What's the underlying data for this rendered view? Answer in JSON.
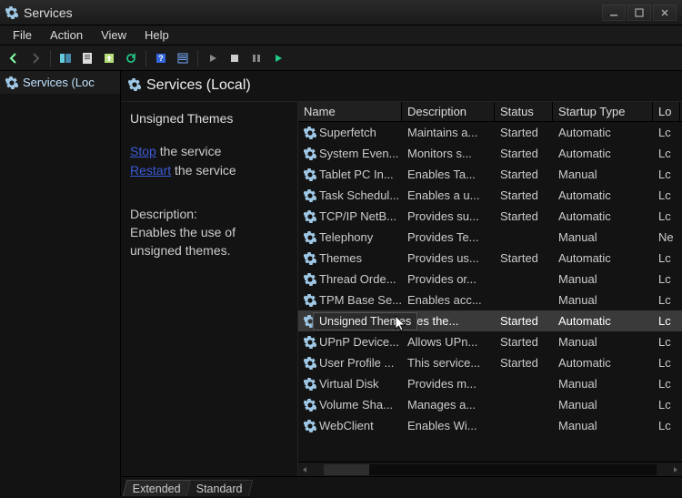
{
  "window": {
    "title": "Services"
  },
  "menu": {
    "items": [
      "File",
      "Action",
      "View",
      "Help"
    ]
  },
  "left": {
    "tab": "Services (Loc"
  },
  "header": {
    "title": "Services (Local)"
  },
  "detail": {
    "service_name": "Unsigned Themes",
    "stop_label": "Stop",
    "stop_suffix": " the service",
    "restart_label": "Restart",
    "restart_suffix": " the service",
    "desc_heading": "Description:",
    "desc_text": "Enables the use of unsigned themes."
  },
  "columns": {
    "name": "Name",
    "description": "Description",
    "status": "Status",
    "startup": "Startup Type",
    "logon": "Lo"
  },
  "rows": [
    {
      "name": "Superfetch",
      "desc": "Maintains a...",
      "status": "Started",
      "start": "Automatic",
      "logon": "Lc"
    },
    {
      "name": "System Even...",
      "desc": "Monitors s...",
      "status": "Started",
      "start": "Automatic",
      "logon": "Lc"
    },
    {
      "name": "Tablet PC In...",
      "desc": "Enables Ta...",
      "status": "Started",
      "start": "Manual",
      "logon": "Lc"
    },
    {
      "name": "Task Schedul...",
      "desc": "Enables a u...",
      "status": "Started",
      "start": "Automatic",
      "logon": "Lc"
    },
    {
      "name": "TCP/IP NetB...",
      "desc": "Provides su...",
      "status": "Started",
      "start": "Automatic",
      "logon": "Lc"
    },
    {
      "name": "Telephony",
      "desc": "Provides Te...",
      "status": "",
      "start": "Manual",
      "logon": "Ne"
    },
    {
      "name": "Themes",
      "desc": "Provides us...",
      "status": "Started",
      "start": "Automatic",
      "logon": "Lc"
    },
    {
      "name": "Thread Orde...",
      "desc": "Provides or...",
      "status": "",
      "start": "Manual",
      "logon": "Lc"
    },
    {
      "name": "TPM Base Se...",
      "desc": "Enables acc...",
      "status": "",
      "start": "Manual",
      "logon": "Lc"
    },
    {
      "name": "Unsigned Th...",
      "desc": "bles the...",
      "status": "Started",
      "start": "Automatic",
      "logon": "Lc",
      "selected": true
    },
    {
      "name": "UPnP Device...",
      "desc": "Allows UPn...",
      "status": "Started",
      "start": "Manual",
      "logon": "Lc"
    },
    {
      "name": "User Profile ...",
      "desc": "This service...",
      "status": "Started",
      "start": "Automatic",
      "logon": "Lc"
    },
    {
      "name": "Virtual Disk",
      "desc": "Provides m...",
      "status": "",
      "start": "Manual",
      "logon": "Lc"
    },
    {
      "name": "Volume Sha...",
      "desc": "Manages a...",
      "status": "",
      "start": "Manual",
      "logon": "Lc"
    },
    {
      "name": "WebClient",
      "desc": "Enables Wi...",
      "status": "",
      "start": "Manual",
      "logon": "Lc"
    }
  ],
  "tooltip": "Unsigned Themes",
  "bottom_tabs": {
    "extended": "Extended",
    "standard": "Standard"
  }
}
